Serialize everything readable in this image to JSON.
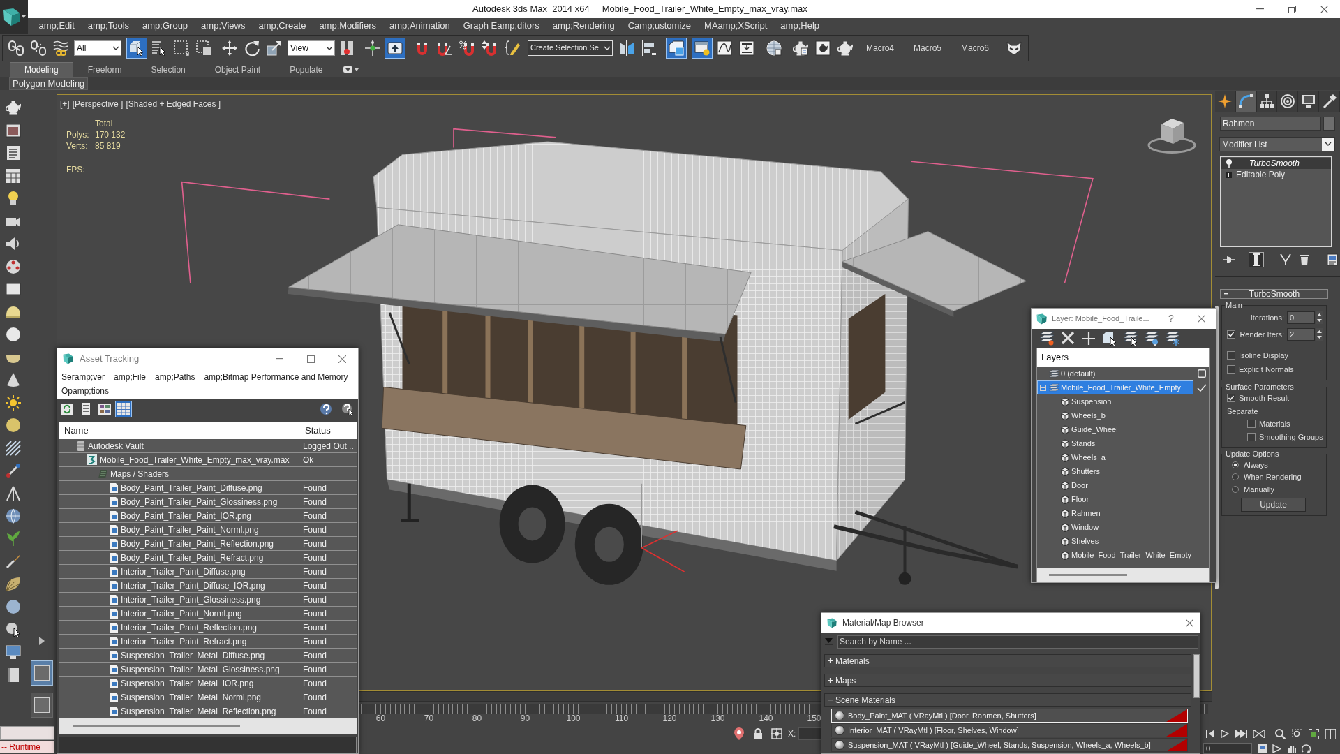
{
  "window": {
    "title": "Autodesk 3ds Max  2014 x64",
    "file": "Mobile_Food_Trailer_White_Empty_max_vray.max"
  },
  "menu": [
    "amp;Edit",
    "amp;Tools",
    "amp;Group",
    "amp;Views",
    "amp;Create",
    "amp;Modifiers",
    "amp;Animation",
    "Graph Eamp;ditors",
    "amp;Rendering",
    "Camp;ustomize",
    "MAamp;XScript",
    "amp;Help"
  ],
  "toolbar": [
    {
      "kind": "link",
      "selected": false
    },
    {
      "kind": "unlink",
      "selected": false
    },
    {
      "kind": "bind",
      "selected": false
    },
    {
      "kind": "dropdown",
      "value": "All"
    },
    {
      "kind": "select",
      "selected": true
    },
    {
      "kind": "select-by-name",
      "selected": false
    },
    {
      "kind": "region",
      "selected": false
    },
    {
      "kind": "crossing",
      "selected": false
    },
    {
      "kind": "move",
      "selected": false
    },
    {
      "kind": "rotate",
      "selected": false
    },
    {
      "kind": "scale",
      "selected": false
    },
    {
      "kind": "dropdown",
      "value": "View"
    },
    {
      "kind": "pivot",
      "selected": false
    },
    {
      "kind": "manipulate",
      "selected": false
    },
    {
      "kind": "keyboard",
      "selected": true
    },
    {
      "kind": "snap",
      "selected": false
    },
    {
      "kind": "angle-snap",
      "selected": false
    },
    {
      "kind": "percent-snap",
      "selected": false
    },
    {
      "kind": "spinner-snap",
      "selected": false
    },
    {
      "kind": "named-sets",
      "selected": false
    },
    {
      "kind": "combo",
      "value": "Create Selection Se"
    },
    {
      "kind": "mirror",
      "selected": false
    },
    {
      "kind": "align",
      "selected": false
    },
    {
      "kind": "scene-explorer",
      "selected": true
    },
    {
      "kind": "layers",
      "selected": true
    },
    {
      "kind": "curve-editor",
      "selected": false
    },
    {
      "kind": "schematic",
      "selected": false
    },
    {
      "kind": "material-editor",
      "selected": false
    },
    {
      "kind": "render-setup",
      "selected": false
    },
    {
      "kind": "frame-window",
      "selected": false
    },
    {
      "kind": "render",
      "selected": false
    },
    {
      "kind": "macro",
      "label": "Macro4"
    },
    {
      "kind": "macro",
      "label": "Macro5"
    },
    {
      "kind": "macro",
      "label": "Macro6"
    },
    {
      "kind": "mask",
      "selected": false
    }
  ],
  "ribbon": {
    "tabs": [
      {
        "label": "Modeling",
        "selected": true
      },
      {
        "label": "Freeform",
        "selected": false
      },
      {
        "label": "Selection",
        "selected": false
      },
      {
        "label": "Object Paint",
        "selected": false
      },
      {
        "label": "Populate",
        "selected": false
      }
    ],
    "panel": "Polygon Modeling"
  },
  "layout_tabs": [
    {
      "selected": true
    },
    {
      "selected": false
    }
  ],
  "viewport": {
    "labels": [
      "[+]",
      "[Perspective ]",
      "[Shaded + Edged Faces ]"
    ],
    "stats": {
      "heading": "Total",
      "rows": [
        {
          "label": "Polys:",
          "value": "170 132"
        },
        {
          "label": "Verts:",
          "value": "85 819"
        }
      ],
      "fps": "FPS:"
    }
  },
  "timeline": {
    "ticks": [
      "60",
      "70",
      "80",
      "90",
      "100",
      "110",
      "120",
      "130",
      "140",
      "150"
    ]
  },
  "status_bar": {
    "listener": "-- Runtime",
    "coordinate": "X:",
    "time": "0"
  },
  "command_panel": {
    "tabs": [
      {
        "kind": "create",
        "selected": false
      },
      {
        "kind": "modify",
        "selected": true
      },
      {
        "kind": "hierarchy",
        "selected": false
      },
      {
        "kind": "motion",
        "selected": false
      },
      {
        "kind": "display",
        "selected": false
      },
      {
        "kind": "utilities",
        "selected": false
      }
    ],
    "object_name": "Rahmen",
    "modifier_list": "Modifier List",
    "stack": [
      {
        "kind": "modifier",
        "label": "TurboSmooth",
        "selected": true
      },
      {
        "kind": "object",
        "label": "Editable Poly",
        "selected": false
      }
    ],
    "stack_tools": [
      {
        "kind": "pin",
        "selected": false
      },
      {
        "kind": "show-end-result",
        "selected": true
      },
      {
        "kind": "make-unique",
        "selected": false
      },
      {
        "kind": "remove",
        "selected": false
      },
      {
        "kind": "configure",
        "selected": false
      }
    ],
    "rollout": {
      "title": "TurboSmooth",
      "expanded": true,
      "groups": [
        {
          "title": "Main",
          "controls": [
            {
              "kind": "spinner",
              "label": "Iterations:",
              "value": "0"
            },
            {
              "kind": "spinner",
              "label": "Render Iters:",
              "value": "2",
              "checked": true
            },
            {
              "kind": "checkbox",
              "label": "Isoline Display",
              "checked": false
            },
            {
              "kind": "checkbox",
              "label": "Explicit Normals",
              "checked": false
            }
          ]
        },
        {
          "title": "Surface Parameters",
          "controls": [
            {
              "kind": "checkbox",
              "label": "Smooth Result",
              "checked": true
            },
            {
              "kind": "label",
              "label": "Separate",
              "children": [
                {
                  "kind": "checkbox",
                  "label": "Materials",
                  "checked": false
                },
                {
                  "kind": "checkbox",
                  "label": "Smoothing Groups",
                  "checked": false
                }
              ]
            }
          ]
        },
        {
          "title": "Update Options",
          "controls": [
            {
              "kind": "radio",
              "label": "Always",
              "selected": true
            },
            {
              "kind": "radio",
              "label": "When Rendering",
              "selected": false
            },
            {
              "kind": "radio",
              "label": "Manually",
              "selected": false
            },
            {
              "kind": "button",
              "label": "Update"
            }
          ]
        }
      ]
    }
  },
  "asset_tracking": {
    "title": "Asset Tracking",
    "menu": [
      "Seramp;ver",
      "amp;File",
      "amp;Paths",
      "amp;Bitmap Performance and Memory",
      "Opamp;tions"
    ],
    "view_buttons": [
      {
        "kind": "refresh",
        "selected": false
      },
      {
        "kind": "list",
        "selected": false
      },
      {
        "kind": "thumbnails",
        "selected": false
      },
      {
        "kind": "table",
        "selected": true
      }
    ],
    "columns": [
      "Name",
      "Status"
    ],
    "tree": [
      {
        "kind": "vault",
        "name": "Autodesk Vault",
        "status": "Logged Out ..",
        "children": [
          {
            "kind": "max-file",
            "name": "Mobile_Food_Trailer_White_Empty_max_vray.max",
            "status": "Ok",
            "children": [
              {
                "kind": "folder",
                "name": "Maps / Shaders",
                "children": [
                  {
                    "kind": "image",
                    "name": "Body_Paint_Trailer_Paint_Diffuse.png",
                    "status": "Found"
                  },
                  {
                    "kind": "image",
                    "name": "Body_Paint_Trailer_Paint_Glossiness.png",
                    "status": "Found"
                  },
                  {
                    "kind": "image",
                    "name": "Body_Paint_Trailer_Paint_IOR.png",
                    "status": "Found"
                  },
                  {
                    "kind": "image",
                    "name": "Body_Paint_Trailer_Paint_Norml.png",
                    "status": "Found"
                  },
                  {
                    "kind": "image",
                    "name": "Body_Paint_Trailer_Paint_Reflection.png",
                    "status": "Found"
                  },
                  {
                    "kind": "image",
                    "name": "Body_Paint_Trailer_Paint_Refract.png",
                    "status": "Found"
                  },
                  {
                    "kind": "image",
                    "name": "Interior_Trailer_Paint_Diffuse.png",
                    "status": "Found"
                  },
                  {
                    "kind": "image",
                    "name": "Interior_Trailer_Paint_Diffuse_IOR.png",
                    "status": "Found"
                  },
                  {
                    "kind": "image",
                    "name": "Interior_Trailer_Paint_Glossiness.png",
                    "status": "Found"
                  },
                  {
                    "kind": "image",
                    "name": "Interior_Trailer_Paint_Norml.png",
                    "status": "Found"
                  },
                  {
                    "kind": "image",
                    "name": "Interior_Trailer_Paint_Reflection.png",
                    "status": "Found"
                  },
                  {
                    "kind": "image",
                    "name": "Interior_Trailer_Paint_Refract.png",
                    "status": "Found"
                  },
                  {
                    "kind": "image",
                    "name": "Suspension_Trailer_Metal_Diffuse.png",
                    "status": "Found"
                  },
                  {
                    "kind": "image",
                    "name": "Suspension_Trailer_Metal_Glossiness.png",
                    "status": "Found"
                  },
                  {
                    "kind": "image",
                    "name": "Suspension_Trailer_Metal_IOR.png",
                    "status": "Found"
                  },
                  {
                    "kind": "image",
                    "name": "Suspension_Trailer_Metal_Norml.png",
                    "status": "Found"
                  },
                  {
                    "kind": "image",
                    "name": "Suspension_Trailer_Metal_Reflection.png",
                    "status": "Found"
                  }
                ]
              }
            ]
          }
        ]
      }
    ]
  },
  "layer_dialog": {
    "title": "Layer: Mobile_Food_Traile...",
    "help": "?",
    "column": "Layers",
    "layers": [
      {
        "name": "0 (default)",
        "current": false,
        "selected": false
      },
      {
        "name": "Mobile_Food_Trailer_White_Empty",
        "current": true,
        "selected": true,
        "expanded": true,
        "children": [
          {
            "name": "Suspension"
          },
          {
            "name": "Wheels_b"
          },
          {
            "name": "Guide_Wheel"
          },
          {
            "name": "Stands"
          },
          {
            "name": "Wheels_a"
          },
          {
            "name": "Shutters"
          },
          {
            "name": "Door"
          },
          {
            "name": "Floor"
          },
          {
            "name": "Rahmen"
          },
          {
            "name": "Window"
          },
          {
            "name": "Shelves"
          },
          {
            "name": "Mobile_Food_Trailer_White_Empty"
          }
        ]
      }
    ]
  },
  "material_browser": {
    "title": "Material/Map Browser",
    "search": {
      "placeholder": "Search by Name ..."
    },
    "groups": [
      {
        "label": "Materials",
        "expanded": false
      },
      {
        "label": "Maps",
        "expanded": false
      },
      {
        "label": "Scene Materials",
        "expanded": true,
        "items": [
          {
            "label": "Body_Paint_MAT ( VRayMtl ) [Door, Rahmen, Shutters]",
            "selected": true
          },
          {
            "label": "Interior_MAT ( VRayMtl ) [Floor, Shelves, Window]",
            "selected": false
          },
          {
            "label": "Suspension_MAT ( VRayMtl ) [Guide_Wheel, Stands, Suspension, Wheels_a, Wheels_b]",
            "selected": false
          }
        ]
      }
    ]
  }
}
